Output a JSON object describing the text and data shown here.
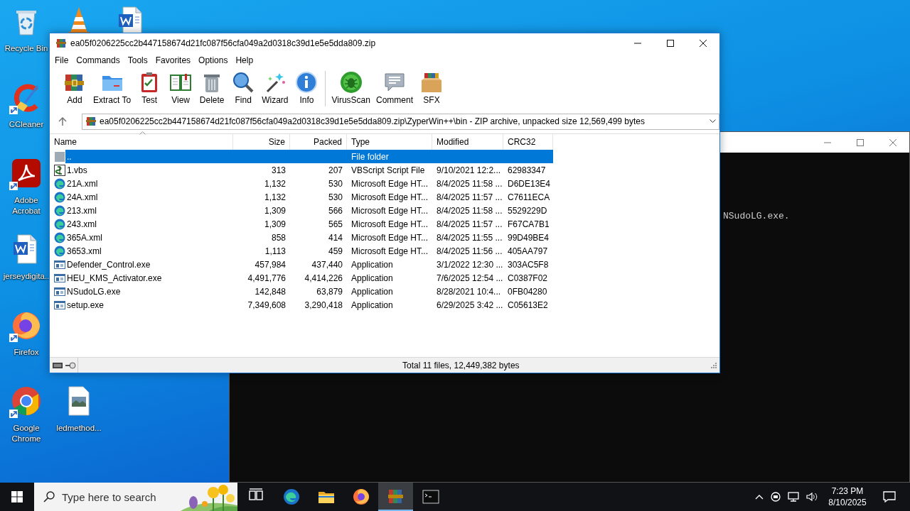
{
  "desktop_icons": [
    {
      "kind": "recycle-bin",
      "label": "Recycle Bin",
      "shortcut": false
    },
    {
      "kind": "cone",
      "shortcut": false
    },
    {
      "kind": "word-document",
      "shortcut": false
    },
    {
      "kind": "ccleaner",
      "label": "CCleaner",
      "shortcut": true
    },
    {
      "kind": "acrobat",
      "label": "Adobe Acrobat",
      "shortcut": true
    },
    {
      "kind": "word-document",
      "label": "jerseydigita..",
      "shortcut": false
    },
    {
      "kind": "firefox",
      "label": "Firefox",
      "shortcut": true
    },
    {
      "kind": "chrome",
      "label": "Google Chrome",
      "shortcut": true
    },
    {
      "kind": "image-file",
      "label": "ledmethod...",
      "shortcut": false
    }
  ],
  "console": {
    "line": "NSudoLG.exe."
  },
  "winrar": {
    "title": "ea05f0206225cc2b447158674d21fc087f56cfa049a2d0318c39d1e5e5dda809.zip",
    "menu": [
      "File",
      "Commands",
      "Tools",
      "Favorites",
      "Options",
      "Help"
    ],
    "toolbar": [
      {
        "kind": "add",
        "label": "Add"
      },
      {
        "kind": "extract",
        "label": "Extract To"
      },
      {
        "kind": "test",
        "label": "Test"
      },
      {
        "kind": "view",
        "label": "View"
      },
      {
        "kind": "delete",
        "label": "Delete"
      },
      {
        "kind": "find",
        "label": "Find"
      },
      {
        "kind": "wizard",
        "label": "Wizard"
      },
      {
        "kind": "info",
        "label": "Info"
      },
      {
        "kind": "virusscan",
        "label": "VirusScan"
      },
      {
        "kind": "comment",
        "label": "Comment"
      },
      {
        "kind": "sfx",
        "label": "SFX"
      }
    ],
    "address": "ea05f0206225cc2b447158674d21fc087f56cfa049a2d0318c39d1e5e5dda809.zip\\ZyperWin++\\bin - ZIP archive, unpacked size 12,569,499 bytes",
    "columns": [
      "Name",
      "Size",
      "Packed",
      "Type",
      "Modified",
      "CRC32"
    ],
    "rows": [
      {
        "kind": "parent",
        "name": "..",
        "size": "",
        "packed": "",
        "type": "File folder",
        "modified": "",
        "crc": "",
        "selected": true
      },
      {
        "kind": "script",
        "name": "1.vbs",
        "size": "313",
        "packed": "207",
        "type": "VBScript Script File",
        "modified": "9/10/2021 12:2...",
        "crc": "62983347",
        "selected": false
      },
      {
        "kind": "web",
        "name": "21A.xml",
        "size": "1,132",
        "packed": "530",
        "type": "Microsoft Edge HT...",
        "modified": "8/4/2025 11:58 ...",
        "crc": "D6DE13E4",
        "selected": false
      },
      {
        "kind": "web",
        "name": "24A.xml",
        "size": "1,132",
        "packed": "530",
        "type": "Microsoft Edge HT...",
        "modified": "8/4/2025 11:57 ...",
        "crc": "C7611ECA",
        "selected": false
      },
      {
        "kind": "web",
        "name": "213.xml",
        "size": "1,309",
        "packed": "566",
        "type": "Microsoft Edge HT...",
        "modified": "8/4/2025 11:58 ...",
        "crc": "5529229D",
        "selected": false
      },
      {
        "kind": "web",
        "name": "243.xml",
        "size": "1,309",
        "packed": "565",
        "type": "Microsoft Edge HT...",
        "modified": "8/4/2025 11:57 ...",
        "crc": "F67CA7B1",
        "selected": false
      },
      {
        "kind": "web",
        "name": "365A.xml",
        "size": "858",
        "packed": "414",
        "type": "Microsoft Edge HT...",
        "modified": "8/4/2025 11:55 ...",
        "crc": "99D49BE4",
        "selected": false
      },
      {
        "kind": "web",
        "name": "3653.xml",
        "size": "1,113",
        "packed": "459",
        "type": "Microsoft Edge HT...",
        "modified": "8/4/2025 11:56 ...",
        "crc": "405AA797",
        "selected": false
      },
      {
        "kind": "exe",
        "name": "Defender_Control.exe",
        "size": "457,984",
        "packed": "437,440",
        "type": "Application",
        "modified": "3/1/2022 12:30 ...",
        "crc": "303AC5F8",
        "selected": false
      },
      {
        "kind": "exe",
        "name": "HEU_KMS_Activator.exe",
        "size": "4,491,776",
        "packed": "4,414,226",
        "type": "Application",
        "modified": "7/6/2025 12:54 ...",
        "crc": "C0387F02",
        "selected": false
      },
      {
        "kind": "exe",
        "name": "NSudoLG.exe",
        "size": "142,848",
        "packed": "63,879",
        "type": "Application",
        "modified": "8/28/2021 10:4...",
        "crc": "0FB04280",
        "selected": false
      },
      {
        "kind": "exe",
        "name": "setup.exe",
        "size": "7,349,608",
        "packed": "3,290,418",
        "type": "Application",
        "modified": "6/29/2025 3:42 ...",
        "crc": "C05613E2",
        "selected": false
      }
    ],
    "status": "Total 11 files, 12,449,382 bytes"
  },
  "taskbar": {
    "search_placeholder": "Type here to search",
    "apps": [
      {
        "kind": "task-view",
        "active": false
      },
      {
        "kind": "edge",
        "active": false
      },
      {
        "kind": "folder",
        "active": false
      },
      {
        "kind": "firefox",
        "active": false
      },
      {
        "kind": "archiver",
        "active": true
      },
      {
        "kind": "terminal",
        "active": false
      }
    ],
    "time": "7:23 PM",
    "date": "8/10/2025"
  }
}
